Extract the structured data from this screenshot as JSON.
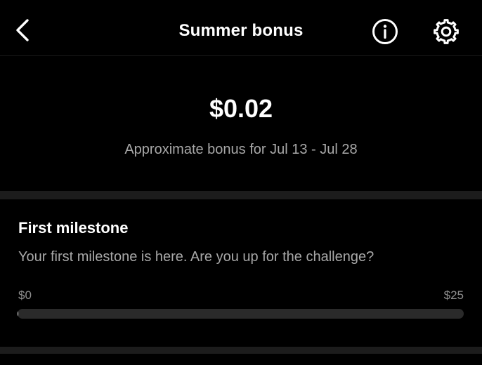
{
  "header": {
    "title": "Summer bonus",
    "back_icon": "chevron-left-icon",
    "info_icon": "info-icon",
    "settings_icon": "gear-icon"
  },
  "summary": {
    "amount": "$0.02",
    "period": "Approximate bonus for Jul 13 - Jul 28"
  },
  "milestone": {
    "title": "First milestone",
    "description": "Your first milestone is here. Are you up for the challenge?",
    "min_label": "$0",
    "max_label": "$25",
    "progress_fraction": 0.0008
  },
  "colors": {
    "background": "#000000",
    "text": "#ffffff",
    "secondary_text": "#a8a8a8",
    "track": "#2a2a2a"
  }
}
